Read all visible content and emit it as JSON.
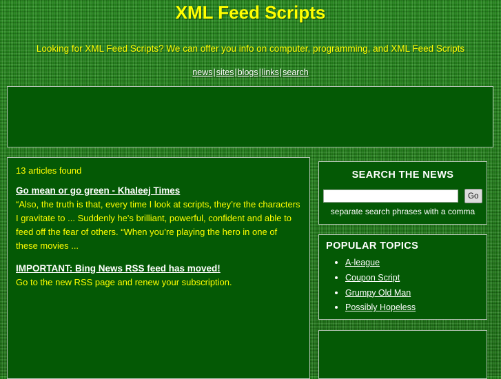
{
  "header": {
    "title": "XML Feed Scripts",
    "tagline": "Looking for XML Feed Scripts? We can offer you info on computer, programming, and XML Feed Scripts",
    "nav": [
      {
        "label": "news"
      },
      {
        "label": "sites"
      },
      {
        "label": "blogs"
      },
      {
        "label": "links"
      },
      {
        "label": "search"
      }
    ],
    "nav_separator": "|"
  },
  "banners": {
    "top": {
      "content": ""
    },
    "sidebar": {
      "content": ""
    }
  },
  "main": {
    "results_count": "13 articles found",
    "articles": [
      {
        "title": "Go mean or go green - Khaleej Times",
        "snippet": "“Also, the truth is that, every time I look at scripts, they’re the characters I gravitate to ... Suddenly he's brilliant, powerful, confident and able to feed off the fear of others. “When you’re playing the hero in one of these movies ..."
      },
      {
        "title": "IMPORTANT: Bing News RSS feed has moved!",
        "snippet": "Go to the new RSS page and renew your subscription."
      }
    ]
  },
  "sidebar": {
    "search": {
      "heading": "SEARCH THE NEWS",
      "input_value": "",
      "input_placeholder": "",
      "go_label": "Go",
      "hint": "separate search phrases with a comma"
    },
    "topics": {
      "heading": "POPULAR TOPICS",
      "items": [
        {
          "label": "A-league"
        },
        {
          "label": "Coupon Script"
        },
        {
          "label": "Grumpy Old Man"
        },
        {
          "label": "Possibly Hopeless"
        }
      ]
    }
  },
  "colors": {
    "page_background": "#1d7a16",
    "panel_background": "#045905",
    "panel_border": "#b8c6b8",
    "title_text": "#ffff00",
    "body_text": "#ffff00",
    "link_text": "#ffffff",
    "button_background": "#dcdcdc"
  }
}
